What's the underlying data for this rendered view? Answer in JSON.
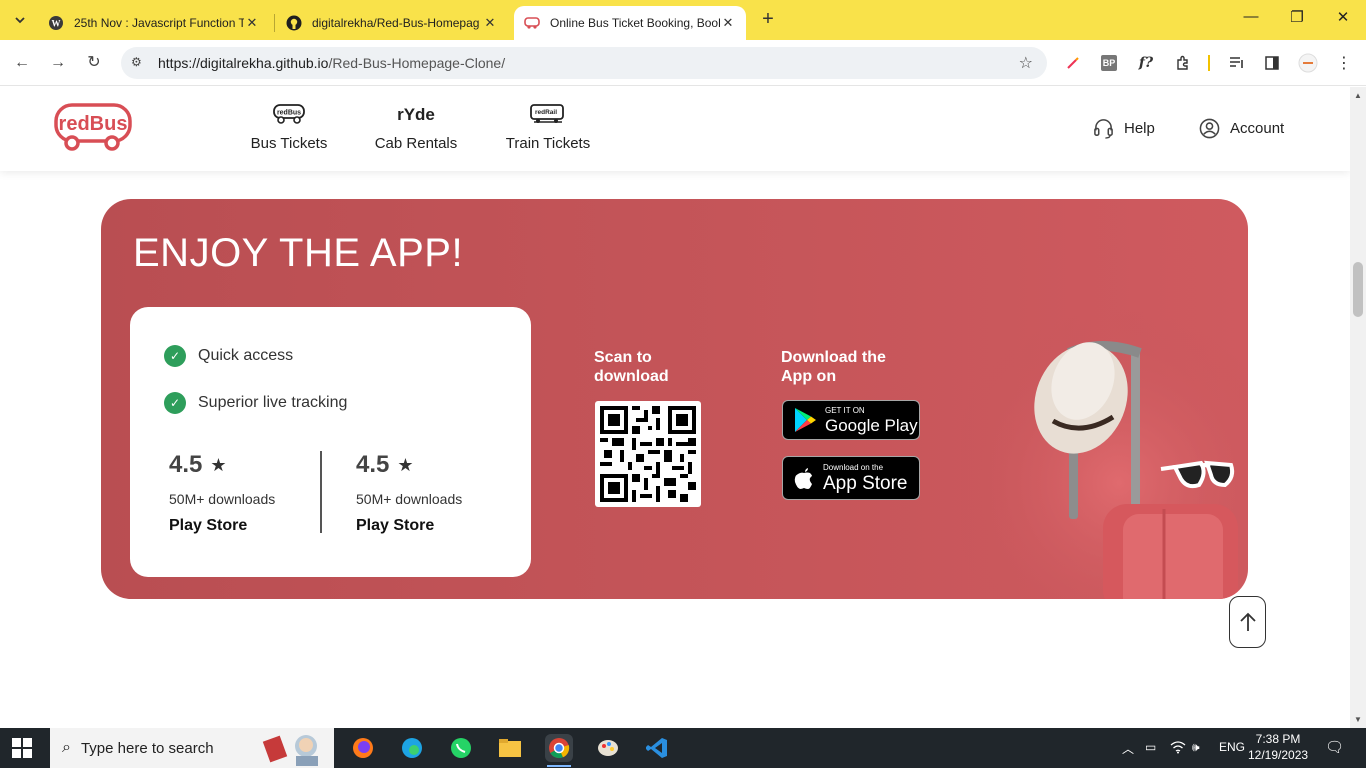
{
  "browser": {
    "tabs": [
      {
        "title": "25th Nov : Javascript Function T",
        "icon": "wordpress-icon",
        "active": false
      },
      {
        "title": "digitalrekha/Red-Bus-Homepag",
        "icon": "github-icon",
        "active": false
      },
      {
        "title": "Online Bus Ticket Booking, Book",
        "icon": "redbus-icon",
        "active": true
      }
    ],
    "url_host": "https://digitalrekha.github.io",
    "url_path": "/Red-Bus-Homepage-Clone/",
    "ext_bp": "BP",
    "ext_f": "f?"
  },
  "header": {
    "logo_text": "redBus",
    "nav": [
      {
        "label": "Bus Tickets",
        "icon_text": "redBus"
      },
      {
        "label": "Cab Rentals",
        "icon_text": "rYde"
      },
      {
        "label": "Train Tickets",
        "icon_text": "redRail"
      }
    ],
    "help": "Help",
    "account": "Account"
  },
  "app_banner": {
    "title": "ENJOY THE APP!",
    "features": [
      "Quick access",
      "Superior live tracking"
    ],
    "ratings": [
      {
        "value": "4.5",
        "downloads": "50M+ downloads",
        "store": "Play Store"
      },
      {
        "value": "4.5",
        "downloads": "50M+ downloads",
        "store": "Play Store"
      }
    ],
    "scan_line1": "Scan to",
    "scan_line2": "download",
    "download_line1": "Download the",
    "download_line2": "App on",
    "google_small": "GET IT ON",
    "google_big": "Google Play",
    "apple_small": "Download on the",
    "apple_big": "App Store",
    "banner_color": "#c55559",
    "check_color": "#2e9e5b"
  },
  "taskbar": {
    "search_placeholder": "Type here to search",
    "language": "ENG",
    "time": "7:38 PM",
    "date": "12/19/2023"
  }
}
